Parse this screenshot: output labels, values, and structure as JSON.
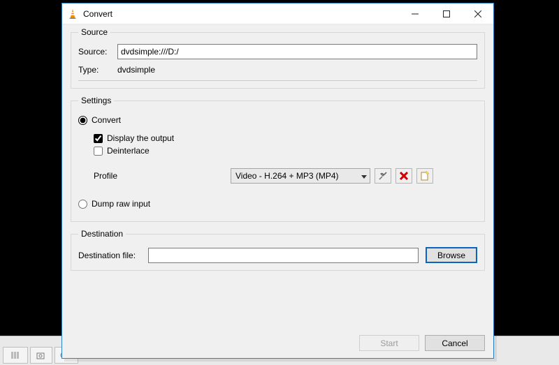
{
  "window": {
    "title": "Convert"
  },
  "source": {
    "legend": "Source",
    "source_label": "Source:",
    "source_value": "dvdsimple:///D:/",
    "type_label": "Type:",
    "type_value": "dvdsimple"
  },
  "settings": {
    "legend": "Settings",
    "convert_label": "Convert",
    "display_output_label": "Display the output",
    "deinterlace_label": "Deinterlace",
    "profile_label": "Profile",
    "profile_value": "Video - H.264 + MP3 (MP4)",
    "dump_raw_label": "Dump raw input"
  },
  "destination": {
    "legend": "Destination",
    "file_label": "Destination file:",
    "file_value": "",
    "browse_label": "Browse"
  },
  "buttons": {
    "start": "Start",
    "cancel": "Cancel"
  }
}
